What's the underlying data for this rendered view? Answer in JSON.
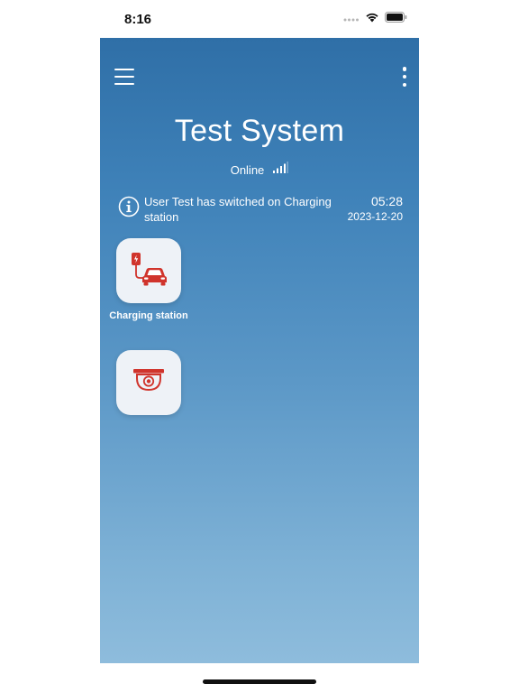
{
  "status_bar": {
    "time": "8:16",
    "icons": [
      "signal-dots-icon",
      "wifi-icon",
      "battery-icon"
    ]
  },
  "header": {
    "menu_icon": "hamburger-menu-icon",
    "more_icon": "more-vertical-icon",
    "title": "Test System"
  },
  "connection": {
    "status": "Online",
    "icon": "signal-strength-icon",
    "signal_level": 3,
    "signal_max": 4
  },
  "notification": {
    "icon": "info-icon",
    "message": "User Test has switched on Charging station",
    "time": "05:28",
    "date": "2023-12-20"
  },
  "devices": [
    {
      "label": "Charging station",
      "icon": "ev-charging-car-icon"
    },
    {
      "label": "",
      "icon": "security-camera-icon"
    }
  ],
  "colors": {
    "gradient_top": "#2f6fa7",
    "gradient_bottom": "#8ebcdc",
    "tile_background": "#eef2f7",
    "icon_accent": "#d0342c"
  }
}
